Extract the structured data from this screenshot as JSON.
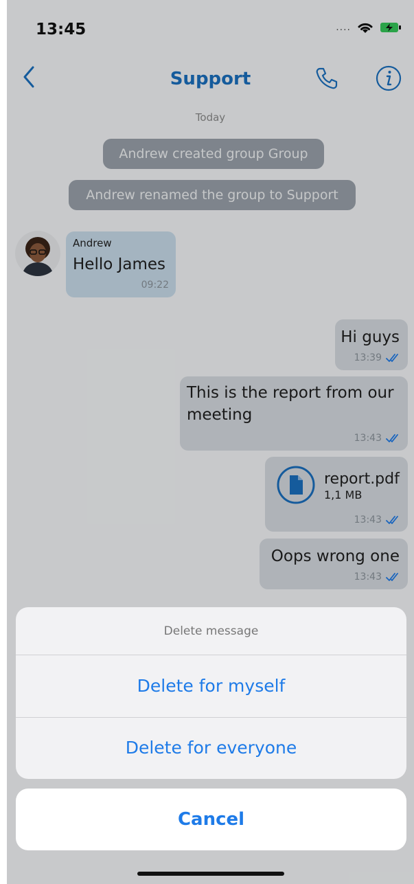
{
  "status_bar": {
    "time": "13:45",
    "signal": "....",
    "icons": [
      "wifi-icon",
      "battery-charging-icon"
    ]
  },
  "nav": {
    "title": "Support",
    "back_icon": "chevron-left-icon",
    "call_icon": "phone-icon",
    "info_icon": "info-icon"
  },
  "conversation": {
    "date_label": "Today",
    "system_messages": [
      "Andrew created group Group",
      "Andrew renamed the group to Support"
    ],
    "incoming": {
      "sender": "Andrew",
      "text": "Hello James",
      "time": "09:22"
    },
    "outgoing": [
      {
        "text": "Hi guys",
        "time": "13:39"
      },
      {
        "text_line1": "This is the report from our",
        "text_line2": "meeting",
        "time": "13:43"
      },
      {
        "file_name": "report.pdf",
        "file_size": "1,1 MB",
        "time": "13:43"
      },
      {
        "text": "Oops wrong one",
        "time": "13:43"
      }
    ]
  },
  "action_sheet": {
    "title": "Delete message",
    "options": [
      "Delete for myself",
      "Delete for everyone"
    ],
    "cancel_label": "Cancel"
  },
  "colors": {
    "accent": "#1a6fbf",
    "action_blue": "#1e7be8",
    "incoming_bubble": "#c8dceb",
    "outgoing_bubble": "#d6dbe1"
  }
}
